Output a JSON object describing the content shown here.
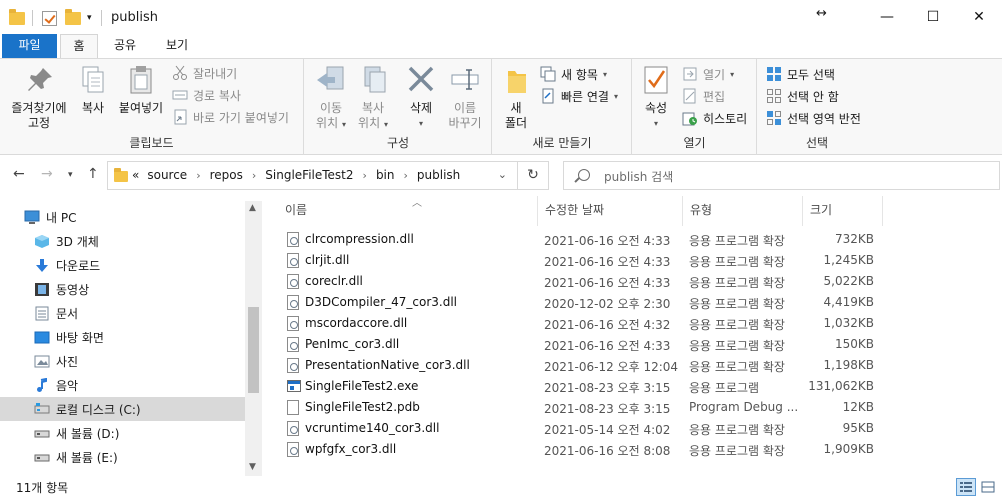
{
  "window": {
    "title": "publish",
    "min_label": "—",
    "max_label": "☐",
    "close_label": "✕",
    "resize_label": "↔"
  },
  "ribbon_tabs": [
    {
      "label": "파일"
    },
    {
      "label": "홈"
    },
    {
      "label": "공유"
    },
    {
      "label": "보기"
    }
  ],
  "ribbon": {
    "clipboard": {
      "label": "클립보드",
      "pin_line1": "즐겨찾기에",
      "pin_line2": "고정",
      "copy": "복사",
      "paste": "붙여넣기",
      "cut": "잘라내기",
      "copy_path": "경로 복사",
      "paste_shortcut": "바로 가기 붙여넣기"
    },
    "organize": {
      "label": "구성",
      "move_line1": "이동",
      "move_line2": "위치",
      "copyto_line1": "복사",
      "copyto_line2": "위치",
      "delete": "삭제",
      "rename_line1": "이름",
      "rename_line2": "바꾸기"
    },
    "new": {
      "label": "새로 만들기",
      "newfolder_line1": "새",
      "newfolder_line2": "폴더",
      "new_item": "새 항목",
      "easy_access": "빠른 연결"
    },
    "open": {
      "label": "열기",
      "properties": "속성",
      "open": "열기",
      "edit": "편집",
      "history": "히스토리"
    },
    "select": {
      "label": "선택",
      "select_all": "모두 선택",
      "select_none": "선택 안 함",
      "invert": "선택 영역 반전"
    }
  },
  "address": {
    "overflow": "«",
    "crumbs": [
      "source",
      "repos",
      "SingleFileTest2",
      "bin",
      "publish"
    ],
    "search_placeholder": "publish 검색"
  },
  "nav_items": [
    {
      "label": "내 PC",
      "icon": "pc-icon"
    },
    {
      "label": "3D 개체",
      "icon": "3d-objects-icon"
    },
    {
      "label": "다운로드",
      "icon": "download-icon"
    },
    {
      "label": "동영상",
      "icon": "video-icon"
    },
    {
      "label": "문서",
      "icon": "document-icon"
    },
    {
      "label": "바탕 화면",
      "icon": "desktop-icon"
    },
    {
      "label": "사진",
      "icon": "pictures-icon"
    },
    {
      "label": "음악",
      "icon": "music-icon"
    },
    {
      "label": "로컬 디스크 (C:)",
      "icon": "drive-icon",
      "selected": true
    },
    {
      "label": "새 볼륨 (D:)",
      "icon": "drive-icon"
    },
    {
      "label": "새 볼륨 (E:)",
      "icon": "drive-icon"
    }
  ],
  "columns": {
    "name": "이름",
    "date": "수정한 날짜",
    "type": "유형",
    "size": "크기"
  },
  "files": [
    {
      "name": "clrcompression.dll",
      "date": "2021-06-16 오전 4:33",
      "type": "응용 프로그램 확장",
      "size": "732KB",
      "kind": "dll"
    },
    {
      "name": "clrjit.dll",
      "date": "2021-06-16 오전 4:33",
      "type": "응용 프로그램 확장",
      "size": "1,245KB",
      "kind": "dll"
    },
    {
      "name": "coreclr.dll",
      "date": "2021-06-16 오전 4:33",
      "type": "응용 프로그램 확장",
      "size": "5,022KB",
      "kind": "dll"
    },
    {
      "name": "D3DCompiler_47_cor3.dll",
      "date": "2020-12-02 오후 2:30",
      "type": "응용 프로그램 확장",
      "size": "4,419KB",
      "kind": "dll"
    },
    {
      "name": "mscordaccore.dll",
      "date": "2021-06-16 오전 4:32",
      "type": "응용 프로그램 확장",
      "size": "1,032KB",
      "kind": "dll"
    },
    {
      "name": "PenImc_cor3.dll",
      "date": "2021-06-16 오전 4:33",
      "type": "응용 프로그램 확장",
      "size": "150KB",
      "kind": "dll"
    },
    {
      "name": "PresentationNative_cor3.dll",
      "date": "2021-06-12 오후 12:04",
      "type": "응용 프로그램 확장",
      "size": "1,198KB",
      "kind": "dll"
    },
    {
      "name": "SingleFileTest2.exe",
      "date": "2021-08-23 오후 3:15",
      "type": "응용 프로그램",
      "size": "131,062KB",
      "kind": "exe"
    },
    {
      "name": "SingleFileTest2.pdb",
      "date": "2021-08-23 오후 3:15",
      "type": "Program Debug ...",
      "size": "12KB",
      "kind": "pdb"
    },
    {
      "name": "vcruntime140_cor3.dll",
      "date": "2021-05-14 오전 4:02",
      "type": "응용 프로그램 확장",
      "size": "95KB",
      "kind": "dll"
    },
    {
      "name": "wpfgfx_cor3.dll",
      "date": "2021-06-16 오전 8:08",
      "type": "응용 프로그램 확장",
      "size": "1,909KB",
      "kind": "dll"
    }
  ],
  "status": {
    "item_count": "11개 항목"
  },
  "colors": {
    "accent": "#1a73c9",
    "folder": "#f4c447",
    "selection": "#d9d9d9"
  }
}
